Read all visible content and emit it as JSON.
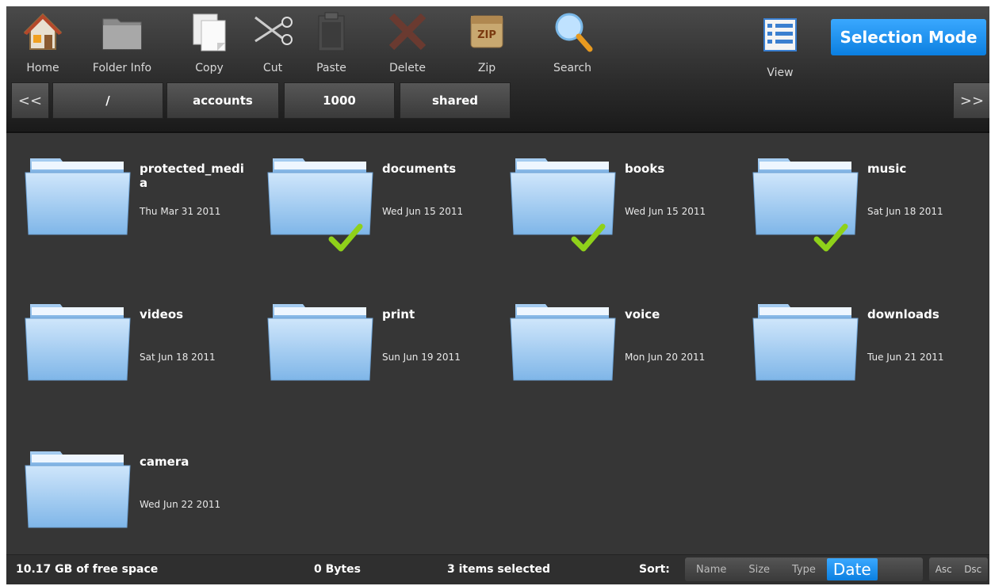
{
  "toolbar": {
    "home": "Home",
    "folder_info": "Folder Info",
    "copy": "Copy",
    "cut": "Cut",
    "paste": "Paste",
    "delete": "Delete",
    "zip": "Zip",
    "zip_badge": "ZIP",
    "search": "Search",
    "view": "View",
    "selection_mode": "Selection Mode"
  },
  "breadcrumb": {
    "back": "<<",
    "forward": ">>",
    "items": [
      "/",
      "accounts",
      "1000",
      "shared"
    ]
  },
  "folders": [
    {
      "name": "protected_media",
      "date": "Thu Mar 31 2011",
      "selected": false
    },
    {
      "name": "documents",
      "date": "Wed Jun 15 2011",
      "selected": true
    },
    {
      "name": "books",
      "date": "Wed Jun 15 2011",
      "selected": true
    },
    {
      "name": "music",
      "date": "Sat Jun 18 2011",
      "selected": true
    },
    {
      "name": "videos",
      "date": "Sat Jun 18 2011",
      "selected": false
    },
    {
      "name": "print",
      "date": "Sun Jun 19 2011",
      "selected": false
    },
    {
      "name": "voice",
      "date": "Mon Jun 20 2011",
      "selected": false
    },
    {
      "name": "downloads",
      "date": "Tue Jun 21 2011",
      "selected": false
    },
    {
      "name": "camera",
      "date": "Wed Jun 22 2011",
      "selected": false
    }
  ],
  "status": {
    "free_space": "10.17 GB of free space",
    "size": "0 Bytes",
    "selected": "3 items selected",
    "sort_label": "Sort:",
    "sort_options": [
      "Name",
      "Size",
      "Type",
      "Date"
    ],
    "sort_active": "Date",
    "asc": "Asc",
    "dsc": "Dsc"
  },
  "colors": {
    "accent": "#1a8cf0",
    "check": "#8fd11a",
    "folder": "#8fc2ef"
  }
}
